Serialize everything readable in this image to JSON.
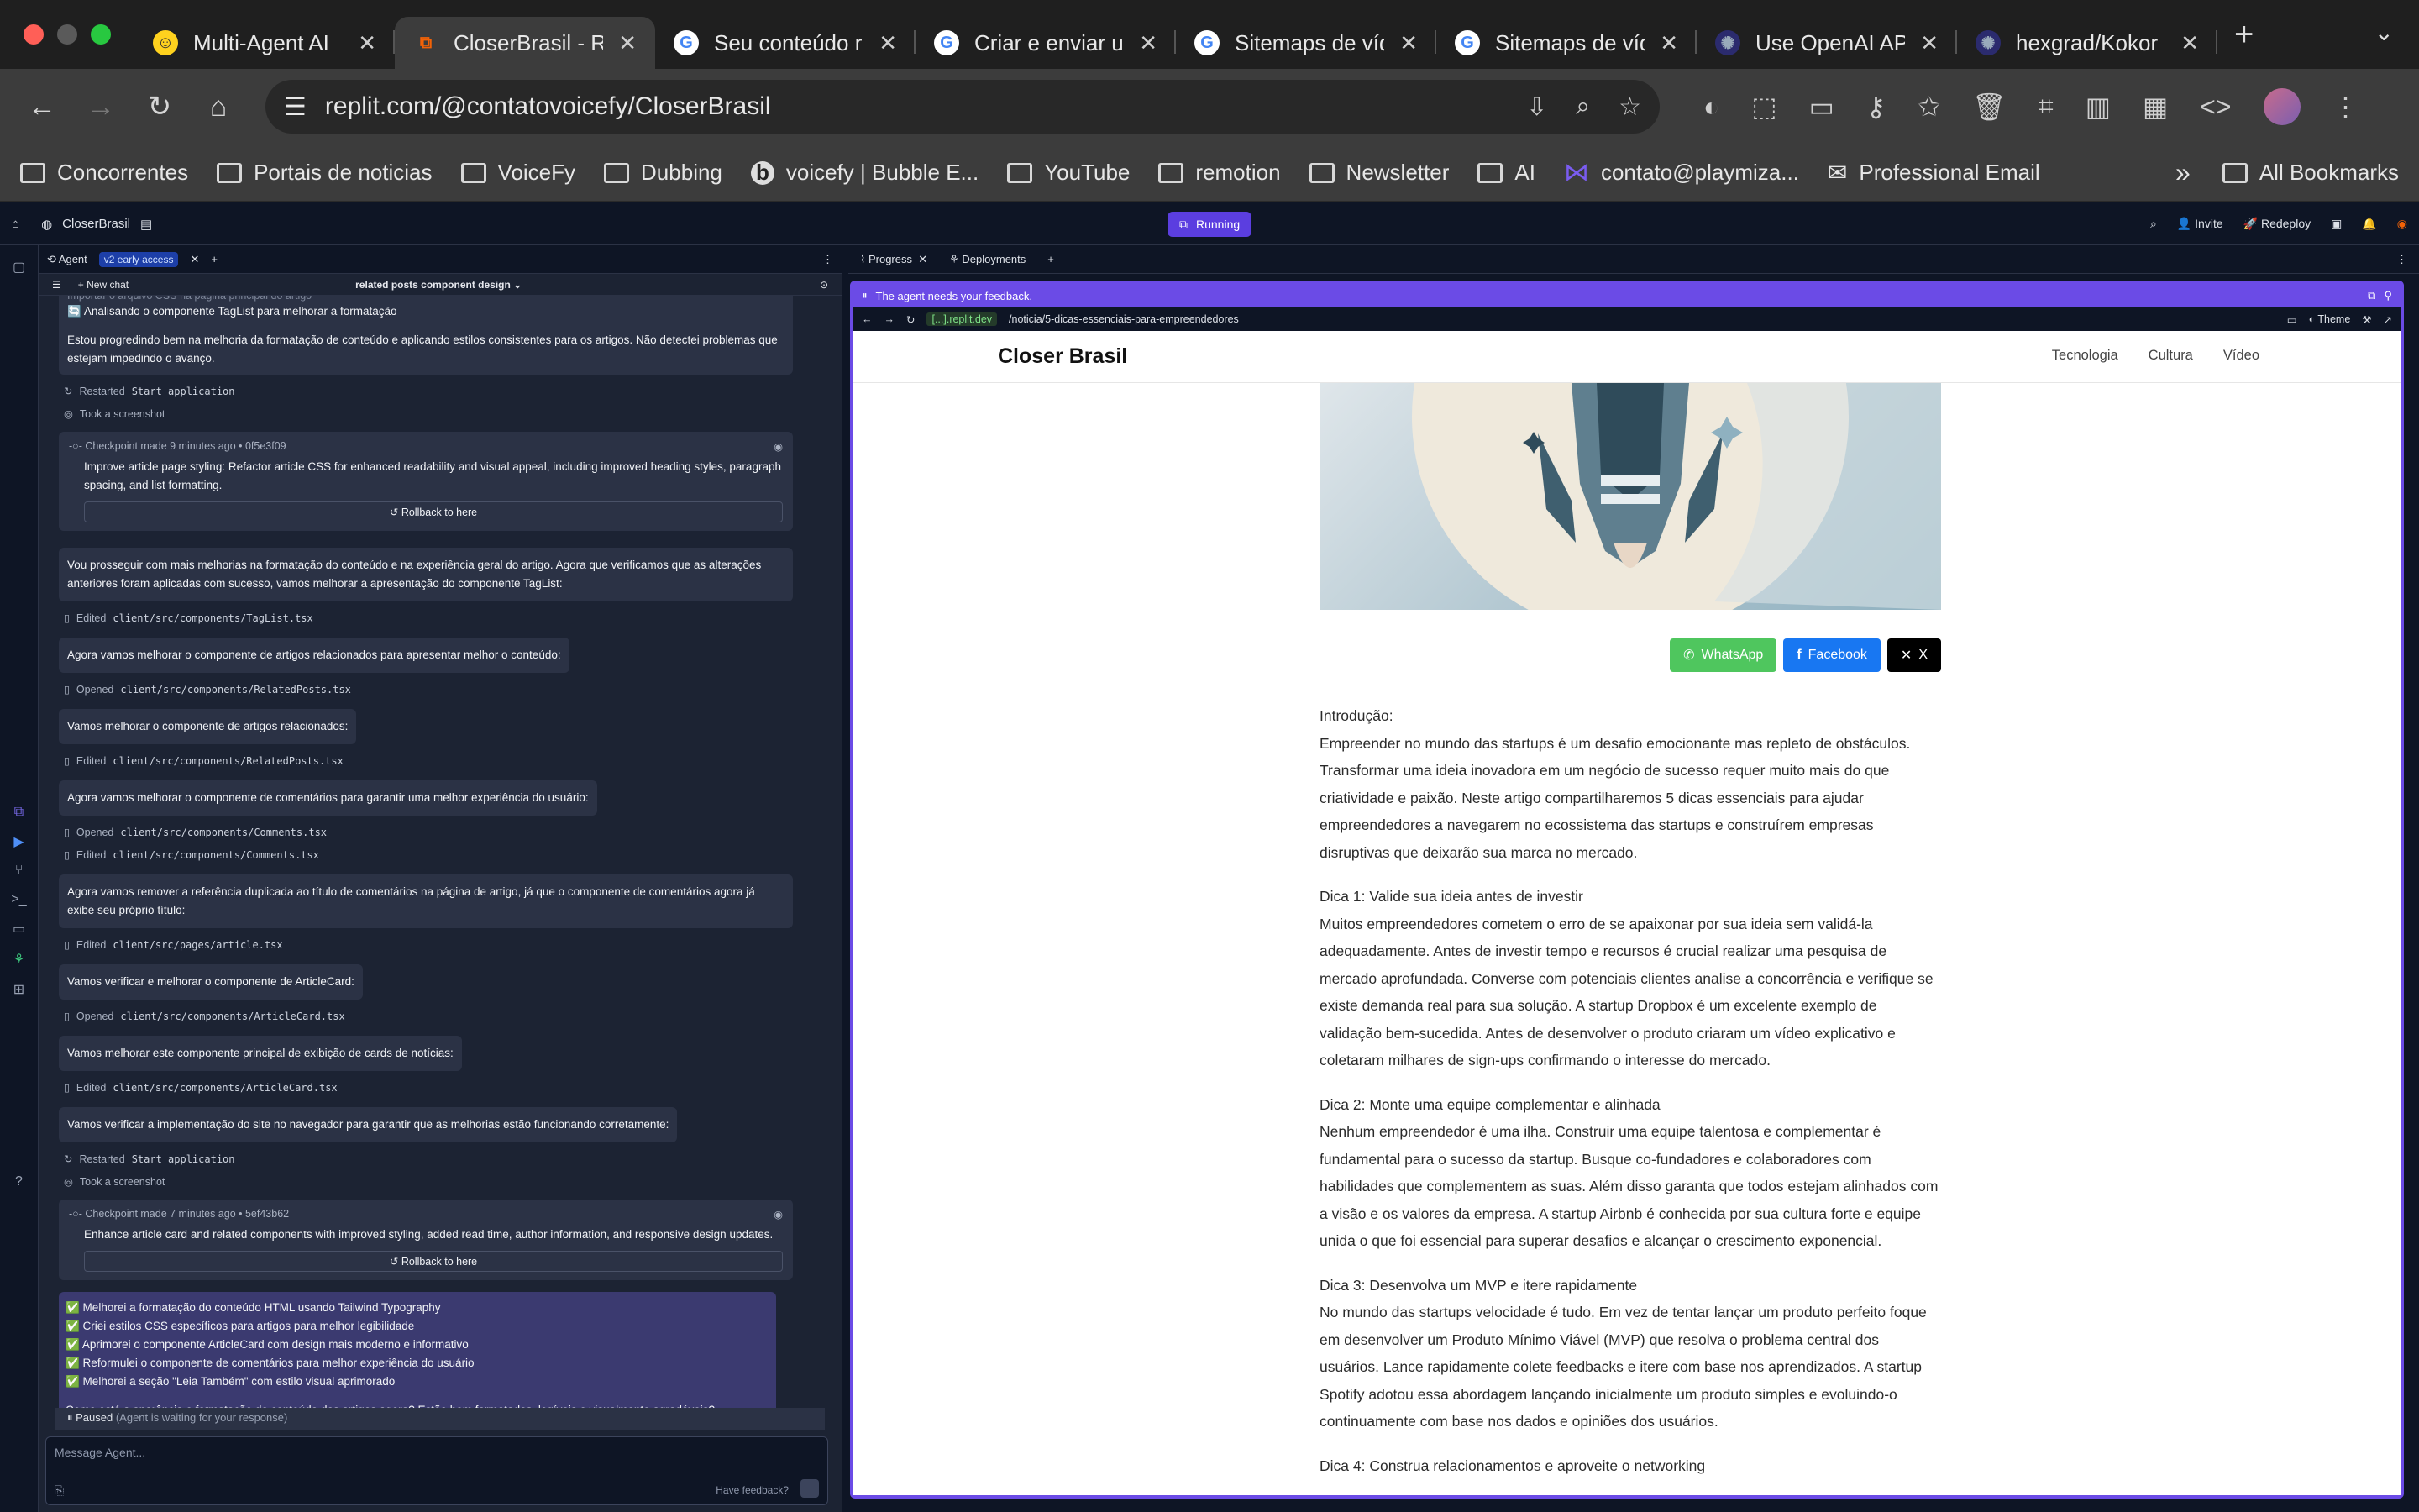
{
  "browser": {
    "tabs": [
      {
        "title": "Multi-Agent AI",
        "favicon": "hugging-face-icon",
        "active": false
      },
      {
        "title": "CloserBrasil - R",
        "favicon": "replit-icon",
        "active": true
      },
      {
        "title": "Seu conteúdo r",
        "favicon": "google-icon",
        "active": false
      },
      {
        "title": "Criar e enviar u",
        "favicon": "google-icon",
        "active": false
      },
      {
        "title": "Sitemaps de víd",
        "favicon": "google-icon",
        "active": false
      },
      {
        "title": "Sitemaps de víd",
        "favicon": "google-icon",
        "active": false
      },
      {
        "title": "Use OpenAI AP",
        "favicon": "openai-icon",
        "active": false
      },
      {
        "title": "hexgrad/Kokor",
        "favicon": "github-icon",
        "active": false
      }
    ],
    "url": "replit.com/@contatovoicefy/CloserBrasil",
    "bookmarks": [
      {
        "label": "Concorrentes"
      },
      {
        "label": "Portais de noticias"
      },
      {
        "label": "VoiceFy"
      },
      {
        "label": "Dubbing"
      },
      {
        "label": "voicefy | Bubble E..."
      },
      {
        "label": "YouTube"
      },
      {
        "label": "remotion"
      },
      {
        "label": "Newsletter"
      },
      {
        "label": "AI"
      },
      {
        "label": "contato@playmiza..."
      },
      {
        "label": "Professional Email"
      }
    ],
    "all_bookmarks": "All Bookmarks",
    "more": "»"
  },
  "replit": {
    "project": "CloserBrasil",
    "status": "Running",
    "invite": "Invite",
    "redeploy": "Redeploy",
    "left_tab": "Agent",
    "left_badge": "v2 early access",
    "new_chat": "New chat",
    "chat_title": "related posts component design",
    "right_tabs": [
      "Progress",
      "Deployments"
    ],
    "paused_label": "Paused",
    "paused_note": "(Agent is waiting for your response)",
    "composer_placeholder": "Message Agent...",
    "have_feedback": "Have feedback?",
    "feedback_banner": "The agent needs your feedback.",
    "webview_domain": "[...].replit.dev",
    "webview_path": "/noticia/5-dicas-essenciais-para-empreendedores",
    "theme": "Theme"
  },
  "chat": {
    "top_cut": "Importar o arquivo CSS na página principal do artigo",
    "analyzing": "🔄 Analisando o componente TagList para melhorar a formatação",
    "msg1": "Estou progredindo bem na melhoria da formatação de conteúdo e aplicando estilos consistentes para os artigos. Não detectei problemas que estejam impedindo o avanço.",
    "restarted1": "Restarted",
    "restarted1_code": "Start application",
    "screenshot1": "Took a screenshot",
    "ckpt1_meta": "Checkpoint made 9 minutes ago • 0f5e3f09",
    "ckpt1_desc": "Improve article page styling: Refactor article CSS for enhanced readability and visual appeal, including improved heading styles, paragraph spacing, and list formatting.",
    "rollback": "Rollback to here",
    "msg2": "Vou prosseguir com mais melhorias na formatação do conteúdo e na experiência geral do artigo. Agora que verificamos que as alterações anteriores foram aplicadas com sucesso, vamos melhorar a apresentação do componente TagList:",
    "edit1": "client/src/components/TagList.tsx",
    "msg3": "Agora vamos melhorar o componente de artigos relacionados para apresentar melhor o conteúdo:",
    "open1": "client/src/components/RelatedPosts.tsx",
    "msg4": "Vamos melhorar o componente de artigos relacionados:",
    "edit2": "client/src/components/RelatedPosts.tsx",
    "msg5": "Agora vamos melhorar o componente de comentários para garantir uma melhor experiência do usuário:",
    "open2": "client/src/components/Comments.tsx",
    "edit3": "client/src/components/Comments.tsx",
    "msg6": "Agora vamos remover a referência duplicada ao título de comentários na página de artigo, já que o componente de comentários agora já exibe seu próprio título:",
    "edit4": "client/src/pages/article.tsx",
    "msg7": "Vamos verificar e melhorar o componente de ArticleCard:",
    "open3": "client/src/components/ArticleCard.tsx",
    "msg8": "Vamos melhorar este componente principal de exibição de cards de notícias:",
    "edit5": "client/src/components/ArticleCard.tsx",
    "msg9": "Vamos verificar a implementação do site no navegador para garantir que as melhorias estão funcionando corretamente:",
    "restarted2": "Restarted",
    "restarted2_code": "Start application",
    "screenshot2": "Took a screenshot",
    "ckpt2_meta": "Checkpoint made 7 minutes ago • 5ef43b62",
    "ckpt2_desc": "Enhance article card and related components with improved styling, added read time, author information, and responsive design updates.",
    "edited": "Edited",
    "opened": "Opened",
    "summary": [
      "✅ Melhorei a formatação do conteúdo HTML usando Tailwind Typography",
      "✅ Criei estilos CSS específicos para artigos para melhor legibilidade",
      "✅ Aprimorei o componente ArticleCard com design mais moderno e informativo",
      "✅ Reformulei o componente de comentários para melhor experiência do usuário",
      "✅ Melhorei a seção \"Leia Também\" com estilo visual aprimorado"
    ],
    "summary_q": "Como está a aparência e formatação do conteúdo dos artigos agora? Estão bem formatados, legíveis e visualmente agradáveis?"
  },
  "site": {
    "brand": "Closer Brasil",
    "nav": [
      "Tecnologia",
      "Cultura",
      "Vídeo"
    ],
    "share": {
      "whatsapp": "WhatsApp",
      "facebook": "Facebook",
      "x": "X"
    },
    "colors": {
      "whatsapp": "#4fc65e",
      "facebook": "#1877f2",
      "x": "#000000"
    },
    "paragraphs": [
      {
        "h": "Introdução:",
        "b": "Empreender no mundo das startups é um desafio emocionante mas repleto de obstáculos. Transformar uma ideia inovadora em um negócio de sucesso requer muito mais do que criatividade e paixão. Neste artigo compartilharemos 5 dicas essenciais para ajudar empreendedores a navegarem no ecossistema das startups e construírem empresas disruptivas que deixarão sua marca no mercado."
      },
      {
        "h": "Dica 1: Valide sua ideia antes de investir",
        "b": "Muitos empreendedores cometem o erro de se apaixonar por sua ideia sem validá-la adequadamente. Antes de investir tempo e recursos é crucial realizar uma pesquisa de mercado aprofundada. Converse com potenciais clientes analise a concorrência e verifique se existe demanda real para sua solução. A startup Dropbox é um excelente exemplo de validação bem-sucedida. Antes de desenvolver o produto criaram um vídeo explicativo e coletaram milhares de sign-ups confirmando o interesse do mercado."
      },
      {
        "h": "Dica 2: Monte uma equipe complementar e alinhada",
        "b": "Nenhum empreendedor é uma ilha. Construir uma equipe talentosa e complementar é fundamental para o sucesso da startup. Busque co-fundadores e colaboradores com habilidades que complementem as suas. Além disso garanta que todos estejam alinhados com a visão e os valores da empresa. A startup Airbnb é conhecida por sua cultura forte e equipe unida o que foi essencial para superar desafios e alcançar o crescimento exponencial."
      },
      {
        "h": "Dica 3: Desenvolva um MVP e itere rapidamente",
        "b": "No mundo das startups velocidade é tudo. Em vez de tentar lançar um produto perfeito foque em desenvolver um Produto Mínimo Viável (MVP) que resolva o problema central dos usuários. Lance rapidamente colete feedbacks e itere com base nos aprendizados. A startup Spotify adotou essa abordagem lançando inicialmente um produto simples e evoluindo-o continuamente com base nos dados e opiniões dos usuários."
      },
      {
        "h": "Dica 4: Construa relacionamentos e aproveite o networking",
        "b": ""
      }
    ]
  }
}
